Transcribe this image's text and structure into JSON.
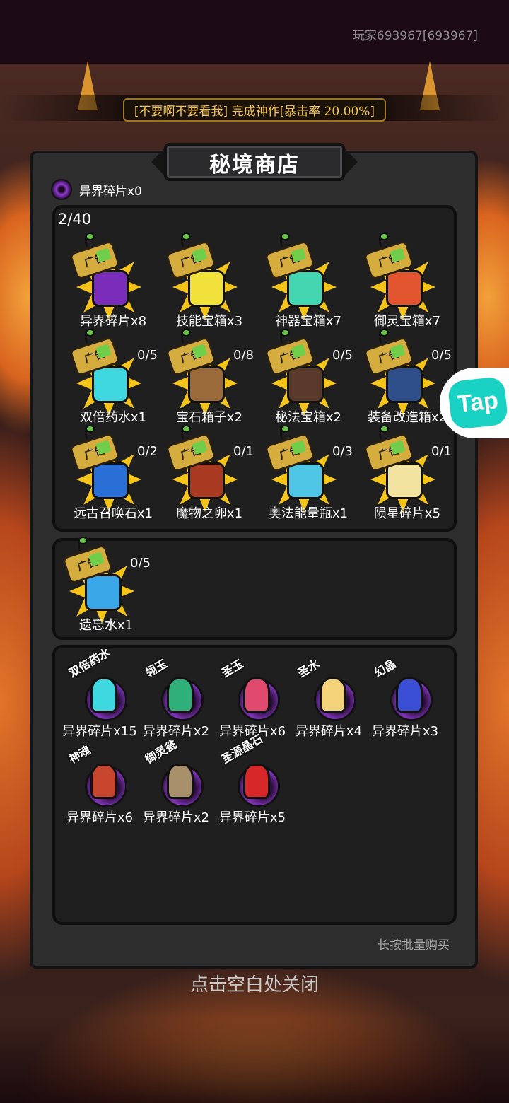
{
  "header": {
    "player_id": "玩家693967[693967]"
  },
  "banner": {
    "text": "[不要啊不要看我] 完成神作[暴击率 20.00%]"
  },
  "shop": {
    "title": "秘境商店",
    "currency_label": "异界碎片x0",
    "ad_counter": "2/40",
    "ad_tag": "广告",
    "ad_items": [
      {
        "label": "异界碎片x8",
        "count": "",
        "icon": "void-orb-icon",
        "color": "#7a2db8"
      },
      {
        "label": "技能宝箱x3",
        "count": "",
        "icon": "skill-chest-icon",
        "color": "#f2e13a"
      },
      {
        "label": "神器宝箱x7",
        "count": "",
        "icon": "artifact-chest-icon",
        "color": "#43d6b0"
      },
      {
        "label": "御灵宝箱x7",
        "count": "",
        "icon": "spirit-chest-icon",
        "color": "#e2552f"
      },
      {
        "label": "双倍药水x1",
        "count": "0/5",
        "icon": "double-potion-icon",
        "color": "#3fd7e0"
      },
      {
        "label": "宝石箱子x2",
        "count": "0/8",
        "icon": "gem-bag-icon",
        "color": "#9a6a3a"
      },
      {
        "label": "秘法宝箱x2",
        "count": "0/5",
        "icon": "arcane-chest-icon",
        "color": "#5a3a2a"
      },
      {
        "label": "装备改造箱x2",
        "count": "0/5",
        "icon": "equipment-box-icon",
        "color": "#2f4f8a"
      },
      {
        "label": "远古召唤石x1",
        "count": "0/2",
        "icon": "summon-stone-icon",
        "color": "#2a6fd6"
      },
      {
        "label": "魔物之卵x1",
        "count": "0/1",
        "icon": "monster-egg-icon",
        "color": "#a83a22"
      },
      {
        "label": "奥法能量瓶x1",
        "count": "0/3",
        "icon": "mana-bottle-icon",
        "color": "#4fc6e6"
      },
      {
        "label": "陨星碎片x5",
        "count": "0/1",
        "icon": "meteor-shard-icon",
        "color": "#f3e3a0"
      }
    ],
    "single_items": [
      {
        "label": "遗忘水x1",
        "count": "0/5",
        "icon": "oblivion-water-icon",
        "color": "#3aa8e8"
      }
    ],
    "shard_items": [
      {
        "name": "双倍药水",
        "price": "异界碎片x15",
        "icon": "double-potion-icon",
        "color": "#3fd7e0"
      },
      {
        "name": "翎玉",
        "price": "异界碎片x2",
        "icon": "jade-icon",
        "color": "#2fb07a"
      },
      {
        "name": "圣玉",
        "price": "异界碎片x6",
        "icon": "holy-jade-icon",
        "color": "#e04a6e"
      },
      {
        "name": "圣水",
        "price": "异界碎片x4",
        "icon": "holy-water-icon",
        "color": "#f3d27a"
      },
      {
        "name": "幻晶",
        "price": "异界碎片x3",
        "icon": "illusion-crystal-icon",
        "color": "#3a4fd6"
      },
      {
        "name": "神魂",
        "price": "异界碎片x6",
        "icon": "divine-soul-icon",
        "color": "#c8452e"
      },
      {
        "name": "御灵瓮",
        "price": "异界碎片x2",
        "icon": "spirit-urn-icon",
        "color": "#a8906a"
      },
      {
        "name": "圣源晶石",
        "price": "异界碎片x5",
        "icon": "source-crystal-icon",
        "color": "#d62828"
      }
    ],
    "bulk_hint": "长按批量购买"
  },
  "close_hint": "点击空白处关闭",
  "sidebar": {
    "tap_label": "Tap"
  }
}
